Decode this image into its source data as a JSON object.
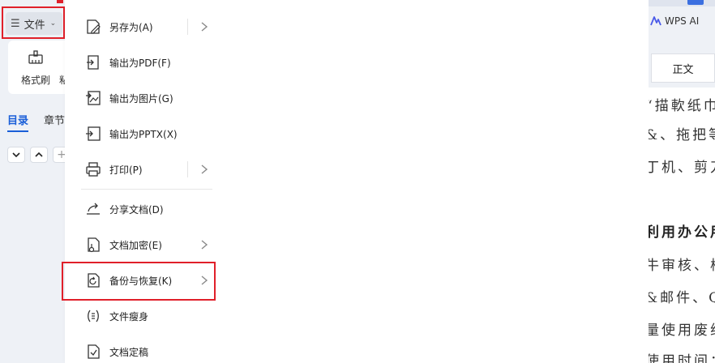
{
  "file_menu_button": {
    "label": "文件"
  },
  "ribbon": {
    "format_painter_label": "格式刷",
    "next_item_partial": "粘"
  },
  "nav_tabs": [
    {
      "label": "目录",
      "active": true
    },
    {
      "label": "章节",
      "active": false
    }
  ],
  "outline_controls": {
    "collapse": "⌄",
    "expand": "⌃",
    "add": "+"
  },
  "menu": {
    "items": [
      {
        "label": "另存为(A)",
        "icon": "save-as-icon",
        "submenu": true
      },
      {
        "label": "输出为PDF(F)",
        "icon": "export-pdf-icon",
        "submenu": false
      },
      {
        "label": "输出为图片(G)",
        "icon": "export-image-icon",
        "submenu": false
      },
      {
        "label": "输出为PPTX(X)",
        "icon": "export-pptx-icon",
        "submenu": false
      },
      {
        "label": "打印(P)",
        "icon": "print-icon",
        "submenu": true
      },
      {
        "label": "分享文档(D)",
        "icon": "share-icon",
        "submenu": false
      },
      {
        "label": "文档加密(E)",
        "icon": "encrypt-icon",
        "submenu": true
      },
      {
        "label": "备份与恢复(K)",
        "icon": "backup-icon",
        "submenu": true,
        "highlighted": true
      },
      {
        "label": "文件瘦身",
        "icon": "slim-file-icon",
        "submenu": false
      },
      {
        "label": "文档定稿",
        "icon": "finalize-icon",
        "submenu": false
      }
    ]
  },
  "right_panel": {
    "wps_ai_label": "WPS AI",
    "style_normal": "正文",
    "doc_lines": [
      "“描軟纸巾",
      "&、拖把等",
      "丁机、剪刀",
      "利用办公用",
      "牛审核、校",
      "&邮件、QQ",
      "量使用废纸",
      "使用时间："
    ]
  },
  "colors": {
    "highlight_box": "#e0202a",
    "accent_blue": "#1a5fd8",
    "panel_bg": "#eef1f6"
  }
}
